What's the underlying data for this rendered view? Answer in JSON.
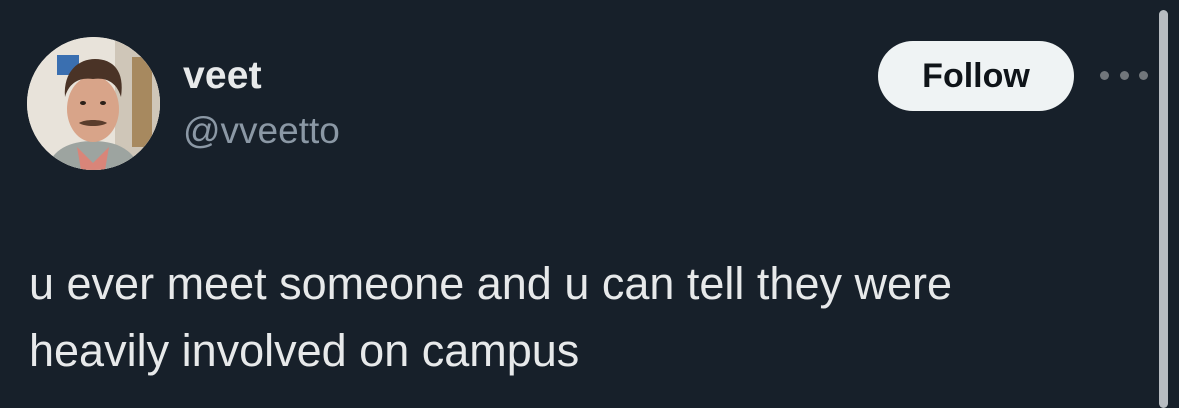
{
  "author": {
    "display_name": "veet",
    "handle": "@vveetto"
  },
  "follow_label": "Follow",
  "tweet": {
    "lines": [
      "u ever meet someone and u can tell they were",
      "heavily involved on campus"
    ]
  },
  "colors": {
    "background": "#17202a",
    "text_primary": "#e7e9ea",
    "text_secondary": "#8b98a5",
    "follow_bg": "#eff3f4",
    "follow_text": "#0f1419"
  },
  "icons": {
    "more": "more-horizontal-icon"
  }
}
